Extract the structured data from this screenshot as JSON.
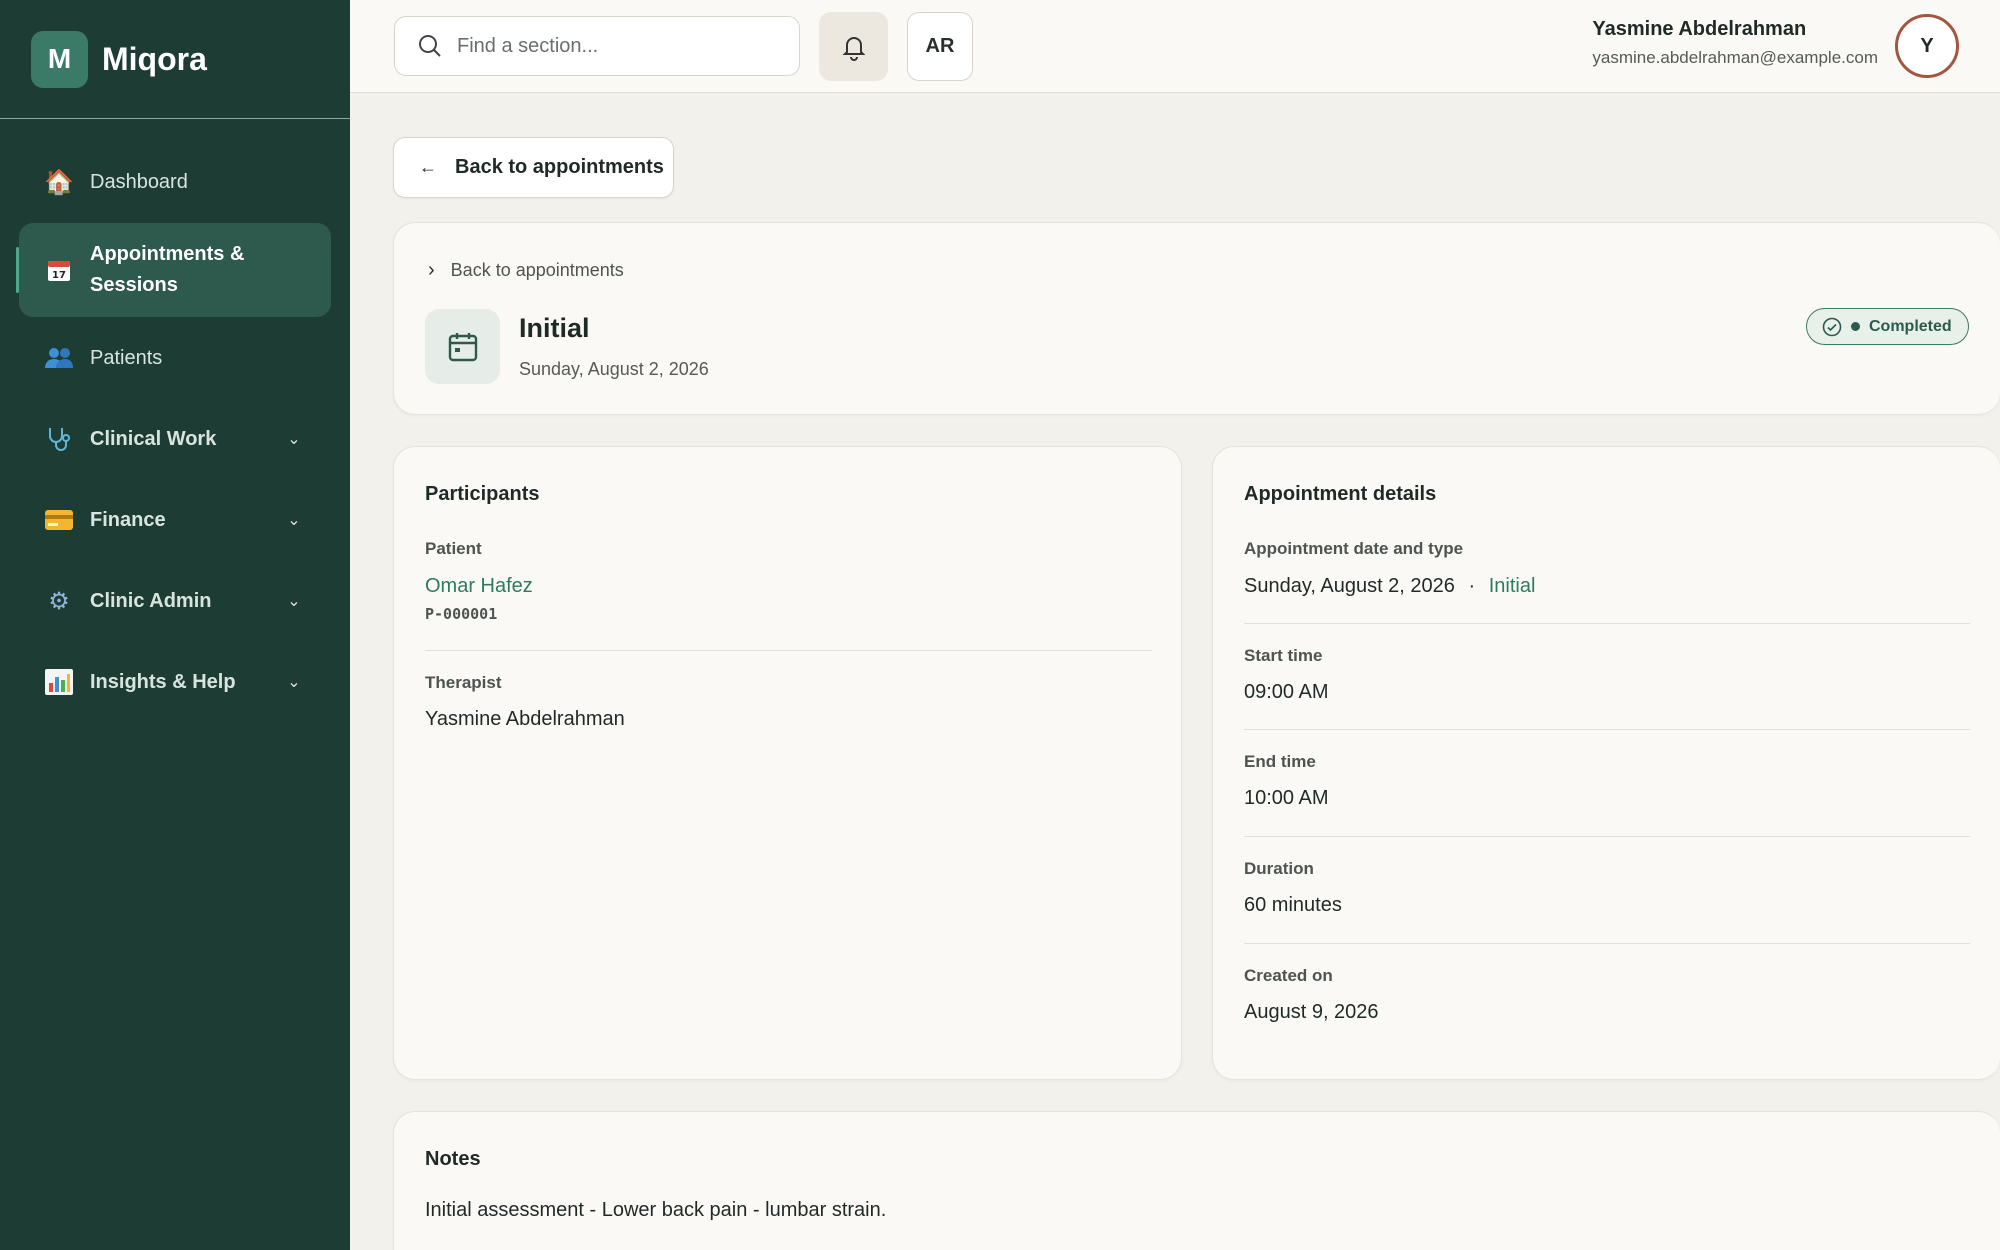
{
  "brand": {
    "logo_letter": "M",
    "name": "Miqora"
  },
  "sidebar": {
    "items": [
      {
        "label": "Dashboard",
        "icon": "house-icon"
      },
      {
        "label": "Appointments & Sessions",
        "icon": "calendar-icon",
        "active": true
      },
      {
        "label": "Patients",
        "icon": "people-icon"
      },
      {
        "label": "Clinical Work",
        "icon": "stethoscope-icon",
        "expandable": true
      },
      {
        "label": "Finance",
        "icon": "credit-card-icon",
        "expandable": true
      },
      {
        "label": "Clinic Admin",
        "icon": "gear-icon",
        "expandable": true
      },
      {
        "label": "Insights & Help",
        "icon": "bar-chart-icon",
        "expandable": true
      }
    ]
  },
  "topbar": {
    "search_placeholder": "Find a section...",
    "language_label": "AR",
    "user_name": "Yasmine Abdelrahman",
    "user_email": "yasmine.abdelrahman@example.com",
    "avatar_letter": "Y"
  },
  "main": {
    "back_button_label": "Back to appointments",
    "header": {
      "breadcrumb": "Back to appointments",
      "title": "Initial",
      "date": "Sunday, August 2, 2026",
      "status": "Completed"
    },
    "participants": {
      "title": "Participants",
      "patient_label": "Patient",
      "patient_name": "Omar Hafez",
      "patient_id": "P-000001",
      "therapist_label": "Therapist",
      "therapist_name": "Yasmine Abdelrahman"
    },
    "details": {
      "title": "Appointment details",
      "date_type_label": "Appointment date and type",
      "date_value": "Sunday, August 2, 2026",
      "separator": "·",
      "type_value": "Initial",
      "start_label": "Start time",
      "start_value": "09:00 AM",
      "end_label": "End time",
      "end_value": "10:00 AM",
      "duration_label": "Duration",
      "duration_value": "60 minutes",
      "created_label": "Created on",
      "created_value": "August 9, 2026"
    },
    "notes": {
      "title": "Notes",
      "text": "Initial assessment - Lower back pain - lumbar strain."
    }
  },
  "colors": {
    "sidebar_bg": "#1d3d34",
    "accent": "#2f7a63",
    "page_bg": "#f3f1ec"
  }
}
